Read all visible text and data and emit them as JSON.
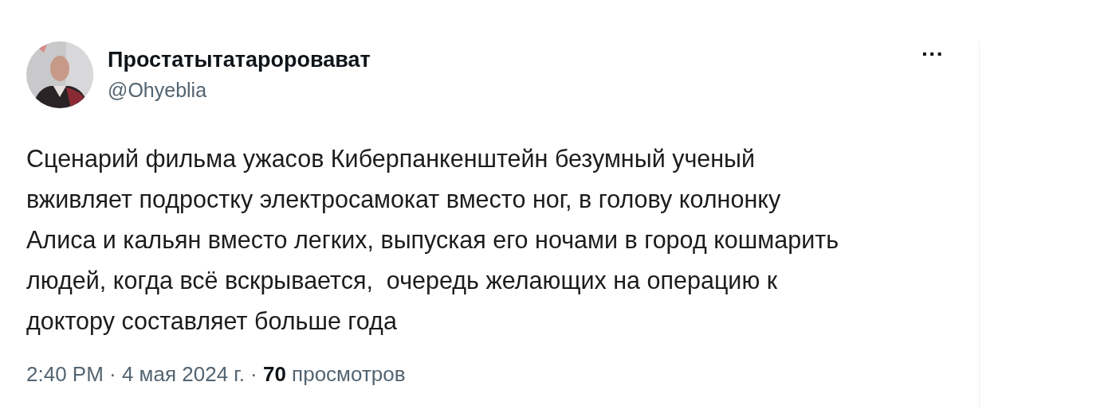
{
  "tweet": {
    "author": {
      "name": "Простатытатароровават",
      "handle": "@Ohyeblia"
    },
    "menu": "···",
    "text": "Сценарий фильма ужасов Киберпанкенштейн безумный ученый\nвживляет подростку электросамокат вместо ног, в голову колнонку\nАлиса и кальян вместо легких, выпуская его ночами в город кошмарить\nлюдей, когда всё вскрывается,  очередь желающих на операцию к\nдоктору составляет больше года",
    "meta": "2:40 PM · 4 мая 2024 г. · **70** просмотров"
  }
}
